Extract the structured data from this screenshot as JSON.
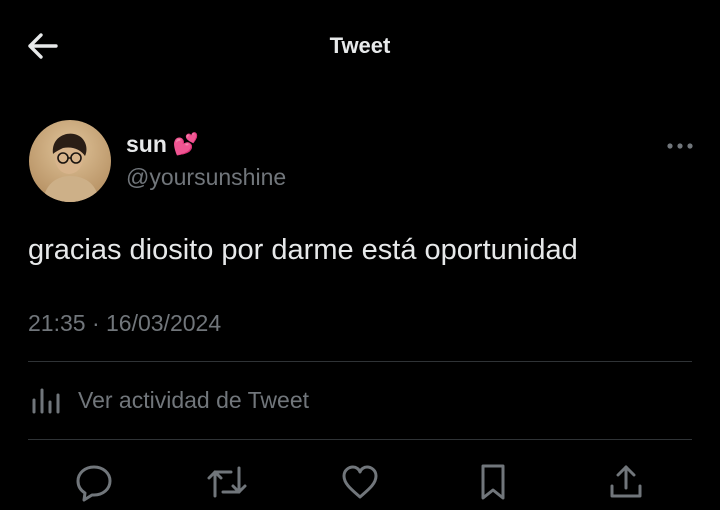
{
  "header": {
    "title": "Tweet",
    "back_icon": "arrow-left-icon"
  },
  "author": {
    "display_name": "sun",
    "emoji": "💕",
    "handle": "@yoursunshine",
    "avatar_icon": "avatar-photo"
  },
  "tweet": {
    "text": "gracias diosito por darme está oportunidad",
    "timestamp": "21:35 · 16/03/2024"
  },
  "activity": {
    "label": "Ver actividad de Tweet",
    "icon": "bar-chart-icon"
  },
  "actions": [
    {
      "name": "reply",
      "icon": "speech-bubble-icon"
    },
    {
      "name": "retweet",
      "icon": "retweet-icon"
    },
    {
      "name": "like",
      "icon": "heart-icon"
    },
    {
      "name": "bookmark",
      "icon": "bookmark-icon"
    },
    {
      "name": "share",
      "icon": "share-icon"
    }
  ],
  "colors": {
    "background": "#000000",
    "text": "#e7e9ea",
    "secondary": "#71767b",
    "divider": "#2f3336"
  }
}
